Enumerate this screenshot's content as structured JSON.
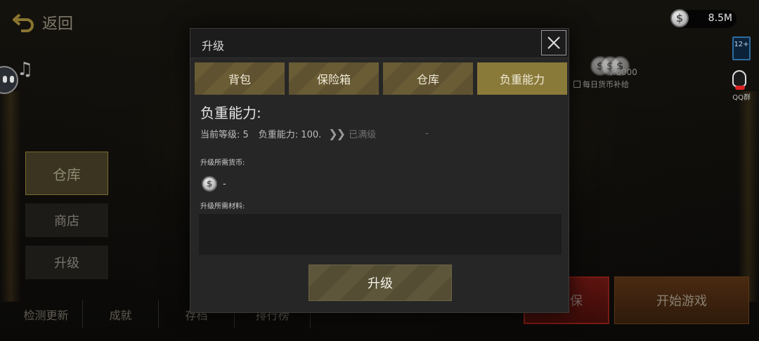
{
  "background": {
    "back_label": "返回",
    "coin_amount": "8.5M",
    "age_rating": "12+",
    "qq_label": "QQ群",
    "daily_count": "X8000",
    "daily_label": "每日货币补给",
    "side_menu": [
      "仓库",
      "商店",
      "升级"
    ],
    "bottom_tabs": [
      "检测更新",
      "成就",
      "存档",
      "排行榜"
    ],
    "insure_label": "保",
    "start_label": "开始游戏"
  },
  "modal": {
    "title": "升级",
    "tabs": [
      "背包",
      "保险箱",
      "仓库",
      "负重能力"
    ],
    "active_tab": "负重能力",
    "section_heading": "负重能力:",
    "level_label": "当前等级: 5",
    "capacity_label": "负重能力: 100.",
    "maxed_label": "已满级",
    "next_value": "-",
    "currency_label": "升级所需货币:",
    "currency_value": "-",
    "materials_label": "升级所需材料:",
    "upgrade_button": "升级"
  },
  "icons": {
    "coin": "silver-dollar-coin",
    "close": "close-x",
    "back": "back-arrow",
    "music": "music-note"
  },
  "colors": {
    "tab_gold": "#8a7a3a",
    "modal_bg": "#262626"
  }
}
